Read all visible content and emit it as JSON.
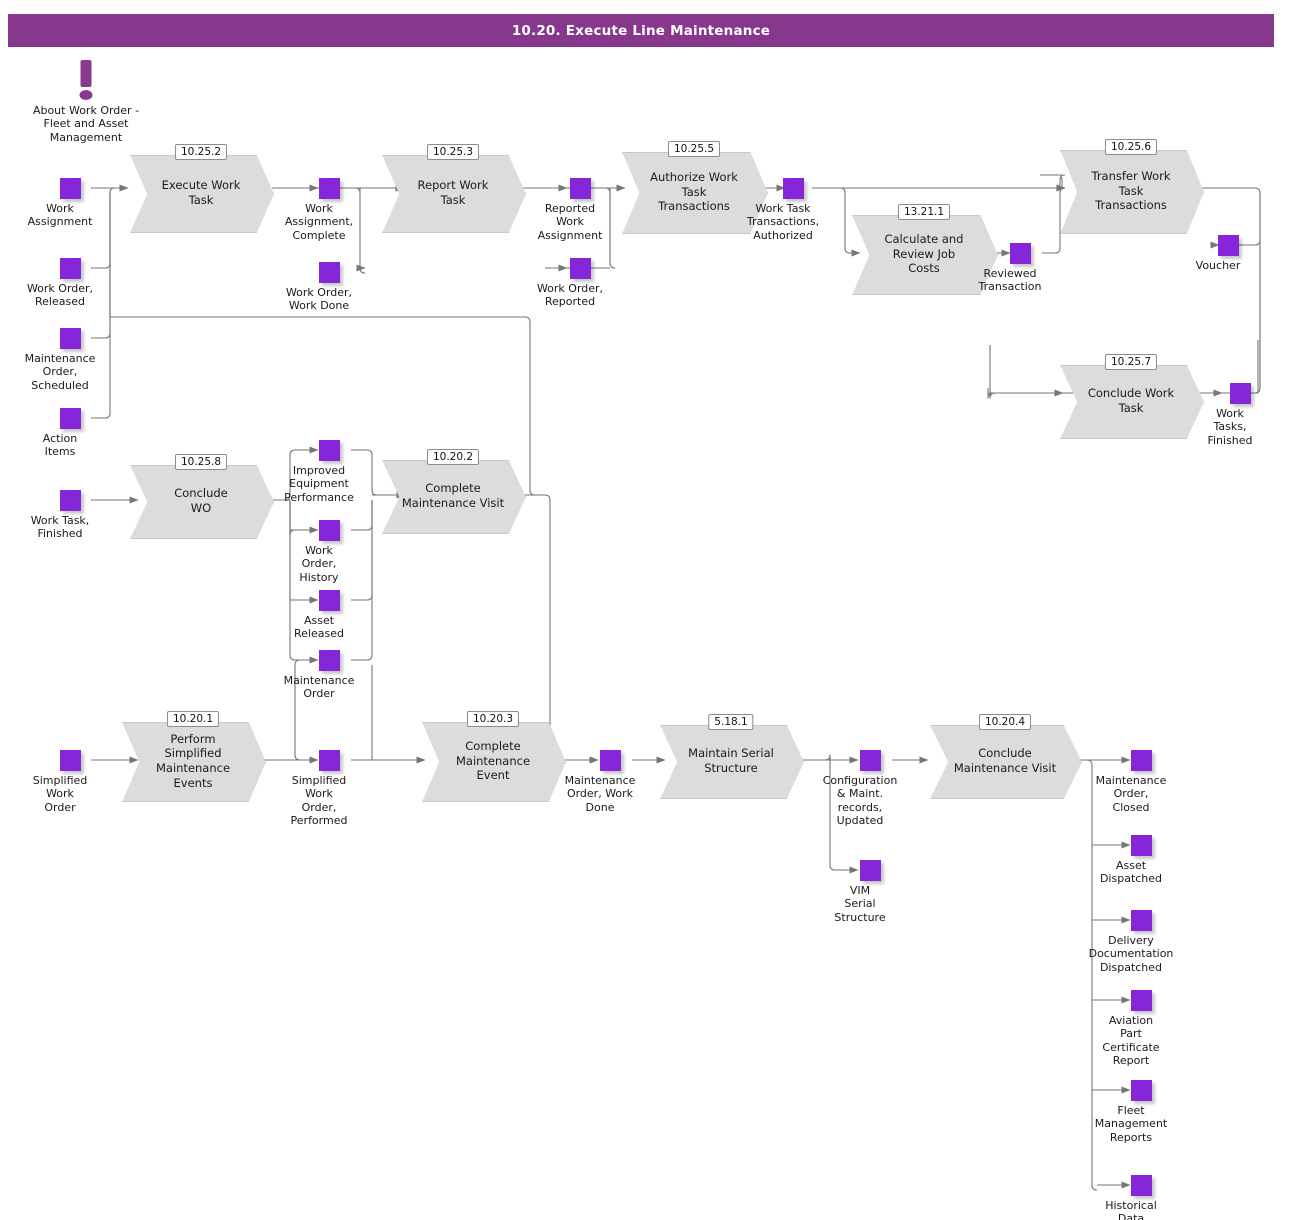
{
  "page": {
    "title": "10.20. Execute Line Maintenance",
    "accent_color": "#88388c",
    "entity_color": "#8526d9",
    "process_fill": "#dcdcdc"
  },
  "note": {
    "icon": "exclamation-icon",
    "label": "About Work Order -\nFleet and Asset\nManagement"
  },
  "processes": [
    {
      "id": "execute-work-task",
      "num": "10.25.2",
      "label": "Execute Work\nTask"
    },
    {
      "id": "report-work-task",
      "num": "10.25.3",
      "label": "Report Work\nTask"
    },
    {
      "id": "authorize-work-task-transactions",
      "num": "10.25.5",
      "label": "Authorize Work\nTask\nTransactions"
    },
    {
      "id": "transfer-work-task-transactions",
      "num": "10.25.6",
      "label": "Transfer Work\nTask\nTransactions"
    },
    {
      "id": "calculate-and-review-job-costs",
      "num": "13.21.1",
      "label": "Calculate and\nReview Job\nCosts"
    },
    {
      "id": "conclude-work-task",
      "num": "10.25.7",
      "label": "Conclude Work\nTask"
    },
    {
      "id": "conclude-wo",
      "num": "10.25.8",
      "label": "Conclude\nWO"
    },
    {
      "id": "complete-maintenance-visit-2",
      "num": "10.20.2",
      "label": "Complete\nMaintenance Visit"
    },
    {
      "id": "perform-simplified-maintenance-events",
      "num": "10.20.1",
      "label": "Perform\nSimplified\nMaintenance\nEvents"
    },
    {
      "id": "complete-maintenance-event",
      "num": "10.20.3",
      "label": "Complete\nMaintenance\nEvent"
    },
    {
      "id": "maintain-serial-structure",
      "num": "5.18.1",
      "label": "Maintain Serial\nStructure"
    },
    {
      "id": "conclude-maintenance-visit-4",
      "num": "10.20.4",
      "label": "Conclude\nMaintenance Visit"
    }
  ],
  "entities": [
    {
      "id": "work-assignment",
      "label": "Work\nAssignment"
    },
    {
      "id": "work-order-released",
      "label": "Work Order,\nReleased"
    },
    {
      "id": "maintenance-order-scheduled",
      "label": "Maintenance\nOrder,\nScheduled"
    },
    {
      "id": "action-items",
      "label": "Action\nItems"
    },
    {
      "id": "work-task-finished",
      "label": "Work Task,\nFinished"
    },
    {
      "id": "simplified-work-order",
      "label": "Simplified\nWork\nOrder"
    },
    {
      "id": "work-assignment-complete",
      "label": "Work\nAssignment,\nComplete"
    },
    {
      "id": "work-order-work-done",
      "label": "Work Order,\nWork Done"
    },
    {
      "id": "reported-work-assignment",
      "label": "Reported\nWork\nAssignment"
    },
    {
      "id": "work-order-reported",
      "label": "Work Order,\nReported"
    },
    {
      "id": "work-task-transactions-authorized",
      "label": "Work Task\nTransactions,\nAuthorized"
    },
    {
      "id": "reviewed-transaction",
      "label": "Reviewed\nTransaction"
    },
    {
      "id": "voucher",
      "label": "Voucher"
    },
    {
      "id": "work-tasks-finished",
      "label": "Work\nTasks,\nFinished"
    },
    {
      "id": "improved-equipment-performance",
      "label": "Improved\nEquipment\nPerformance"
    },
    {
      "id": "work-order-history",
      "label": "Work\nOrder,\nHistory"
    },
    {
      "id": "asset-released",
      "label": "Asset\nReleased"
    },
    {
      "id": "maintenance-order",
      "label": "Maintenance\nOrder"
    },
    {
      "id": "simplified-work-order-performed",
      "label": "Simplified\nWork\nOrder,\nPerformed"
    },
    {
      "id": "maintenance-order-work-done",
      "label": "Maintenance\nOrder, Work\nDone"
    },
    {
      "id": "configuration-maint-records-updated",
      "label": "Configuration\n& Maint.\nrecords,\nUpdated"
    },
    {
      "id": "vim-serial-structure",
      "label": "VIM\nSerial\nStructure"
    },
    {
      "id": "maintenance-order-closed",
      "label": "Maintenance\nOrder,\nClosed"
    },
    {
      "id": "asset-dispatched",
      "label": "Asset\nDispatched"
    },
    {
      "id": "delivery-documentation-dispatched",
      "label": "Delivery\nDocumentation\nDispatched"
    },
    {
      "id": "aviation-part-certificate-report",
      "label": "Aviation\nPart\nCertificate\nReport"
    },
    {
      "id": "fleet-management-reports",
      "label": "Fleet\nManagement\nReports"
    },
    {
      "id": "historical-data",
      "label": "Historical\nData"
    }
  ]
}
